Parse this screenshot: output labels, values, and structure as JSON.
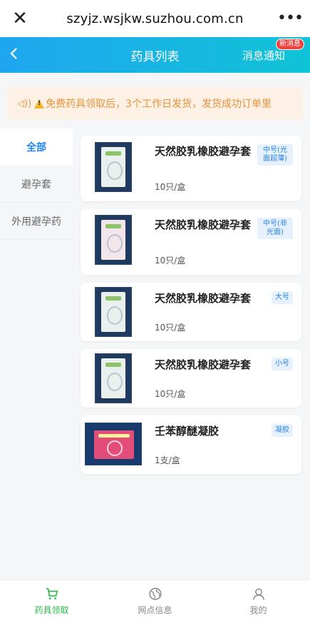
{
  "browser": {
    "close_icon": "close-icon",
    "url": "szyjz.wsjkw.suzhou.com.cn",
    "more_icon": "more-icon"
  },
  "header": {
    "back_icon": "back-icon",
    "title": "药具列表",
    "notify_label": "消息通知",
    "badge": "新消息"
  },
  "notice": {
    "text": "免费药具领取后，3个工作日发货，发货成功订单里"
  },
  "sidebar": {
    "items": [
      {
        "label": "全部",
        "active": true
      },
      {
        "label": "避孕套",
        "active": false
      },
      {
        "label": "外用避孕药",
        "active": false
      }
    ]
  },
  "products": [
    {
      "name": "天然胶乳橡胶避孕套",
      "spec": "10只/盒",
      "tag": "中号(光面超薄)"
    },
    {
      "name": "天然胶乳橡胶避孕套",
      "spec": "10只/盒",
      "tag": "中号(非光面)"
    },
    {
      "name": "天然胶乳橡胶避孕套",
      "spec": "10只/盒",
      "tag": "大号"
    },
    {
      "name": "天然胶乳橡胶避孕套",
      "spec": "10只/盒",
      "tag": "小号"
    },
    {
      "name": "壬苯醇醚凝胶",
      "spec": "1支/盒",
      "tag": "凝胶"
    }
  ],
  "tabbar": {
    "items": [
      {
        "label": "药具领取",
        "icon": "cart-icon",
        "active": true
      },
      {
        "label": "网点信息",
        "icon": "globe-icon",
        "active": false
      },
      {
        "label": "我的",
        "icon": "user-icon",
        "active": false
      }
    ]
  },
  "colors": {
    "accent": "#1f86f0",
    "header_start": "#1fa6f0",
    "header_end": "#10c3d6",
    "notice_text": "#e8923a",
    "tab_active": "#2db84a",
    "badge": "#f0413d"
  }
}
